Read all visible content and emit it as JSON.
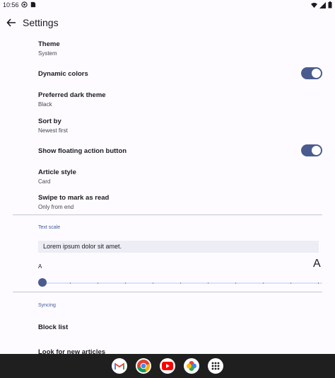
{
  "status_bar": {
    "time": "10:56"
  },
  "app_bar": {
    "title": "Settings"
  },
  "prefs": {
    "theme": {
      "title": "Theme",
      "value": "System"
    },
    "dynamic_colors": {
      "title": "Dynamic colors",
      "enabled": true
    },
    "dark_theme": {
      "title": "Preferred dark theme",
      "value": "Black"
    },
    "sort_by": {
      "title": "Sort by",
      "value": "Newest first"
    },
    "fab": {
      "title": "Show floating action button",
      "enabled": true
    },
    "article_style": {
      "title": "Article style",
      "value": "Card"
    },
    "swipe": {
      "title": "Swipe to mark as read",
      "value": "Only from end"
    }
  },
  "text_scale": {
    "header": "Text scale",
    "preview": "Lorem ipsum dolor sit amet.",
    "small_label": "A",
    "large_label": "A",
    "value_fraction": 0.0
  },
  "syncing": {
    "header": "Syncing",
    "block_list": "Block list",
    "look_for_new": "Look for new articles"
  },
  "colors": {
    "accent": "#4a5c8f",
    "section_header": "#3f5a99",
    "background": "#fdfbff"
  },
  "dock": [
    "gmail-icon",
    "chrome-icon",
    "youtube-icon",
    "photos-icon",
    "app-drawer-icon"
  ]
}
